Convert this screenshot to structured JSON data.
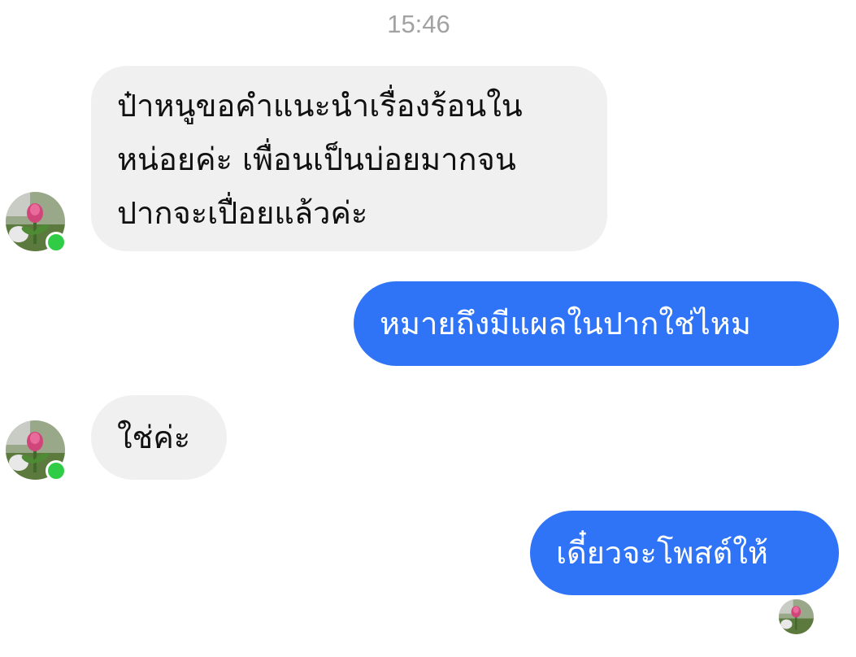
{
  "timestamp": "15:46",
  "messages": [
    {
      "direction": "incoming",
      "text": "ป๋าหนูขอคำแนะนำเรื่องร้อนใน\nหน่อยค่ะ เพื่อนเป็นบ่อยมากจน\nปากจะเปื่อยแล้วค่ะ"
    },
    {
      "direction": "outgoing",
      "text": "หมายถึงมีแผลในปากใช่ไหม"
    },
    {
      "direction": "incoming",
      "text": "ใช่ค่ะ"
    },
    {
      "direction": "outgoing",
      "text": "เดี๋ยวจะโพสต์ให้"
    }
  ],
  "colors": {
    "incoming_bubble": "#f0f0f0",
    "outgoing_bubble": "#2f74f7",
    "online_indicator": "#31cc46",
    "timestamp_text": "#a2a2a2"
  },
  "icons": {
    "contact_avatar": "flower-photo-avatar",
    "online_status": "online-status-dot",
    "seen_receipt": "seen-avatar-icon"
  }
}
